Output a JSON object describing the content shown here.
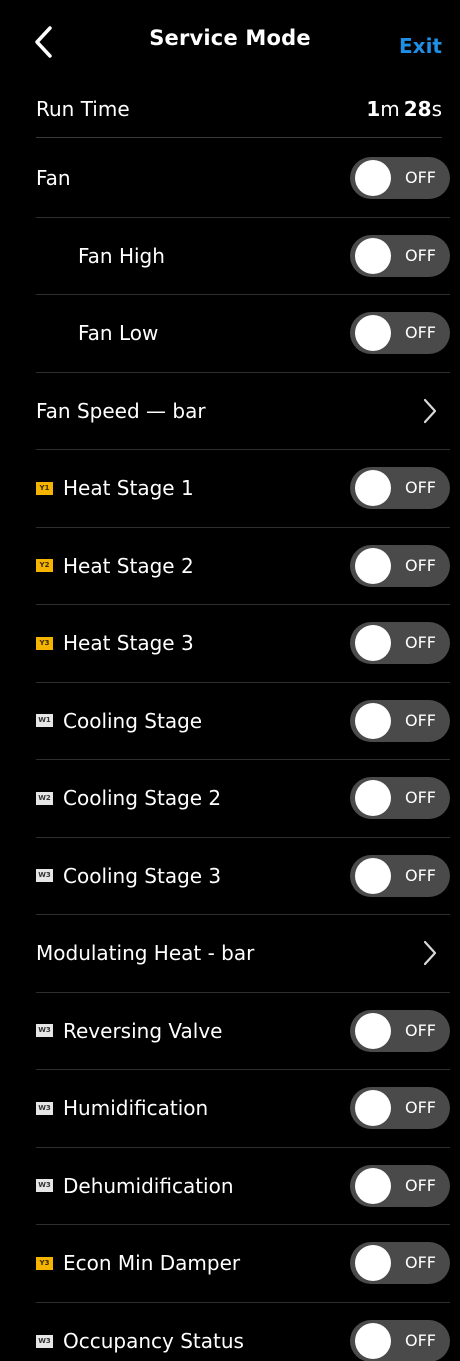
{
  "header": {
    "title": "Service Mode",
    "exit_label": "Exit",
    "accent_color": "#1f8fe5"
  },
  "run_time": {
    "label": "Run Time",
    "minutes": "1",
    "minutes_unit": "m",
    "seconds": "28",
    "seconds_unit": "s"
  },
  "rows": [
    {
      "kind": "toggle",
      "label": "Fan",
      "indent": false,
      "badge": "",
      "badge_color": "",
      "state": "OFF"
    },
    {
      "kind": "toggle",
      "label": "Fan High",
      "indent": true,
      "badge": "",
      "badge_color": "",
      "state": "OFF"
    },
    {
      "kind": "toggle",
      "label": "Fan Low",
      "indent": true,
      "badge": "",
      "badge_color": "",
      "state": "OFF"
    },
    {
      "kind": "nav",
      "label": "Fan Speed — bar",
      "indent": false,
      "badge": "",
      "badge_color": ""
    },
    {
      "kind": "toggle",
      "label": "Heat Stage 1",
      "indent": false,
      "badge": "Y1",
      "badge_color": "yellow",
      "state": "OFF"
    },
    {
      "kind": "toggle",
      "label": "Heat Stage 2",
      "indent": false,
      "badge": "Y2",
      "badge_color": "yellow",
      "state": "OFF"
    },
    {
      "kind": "toggle",
      "label": "Heat Stage 3",
      "indent": false,
      "badge": "Y3",
      "badge_color": "yellow",
      "state": "OFF"
    },
    {
      "kind": "toggle",
      "label": "Cooling Stage",
      "indent": false,
      "badge": "W1",
      "badge_color": "white",
      "state": "OFF"
    },
    {
      "kind": "toggle",
      "label": "Cooling Stage 2",
      "indent": false,
      "badge": "W2",
      "badge_color": "white",
      "state": "OFF"
    },
    {
      "kind": "toggle",
      "label": "Cooling Stage 3",
      "indent": false,
      "badge": "W3",
      "badge_color": "white",
      "state": "OFF"
    },
    {
      "kind": "nav",
      "label": "Modulating Heat - bar",
      "indent": false,
      "badge": "",
      "badge_color": ""
    },
    {
      "kind": "toggle",
      "label": "Reversing Valve",
      "indent": false,
      "badge": "W3",
      "badge_color": "white",
      "state": "OFF"
    },
    {
      "kind": "toggle",
      "label": "Humidification",
      "indent": false,
      "badge": "W3",
      "badge_color": "white",
      "state": "OFF"
    },
    {
      "kind": "toggle",
      "label": "Dehumidification",
      "indent": false,
      "badge": "W3",
      "badge_color": "white",
      "state": "OFF"
    },
    {
      "kind": "toggle",
      "label": "Econ Min Damper",
      "indent": false,
      "badge": "Y3",
      "badge_color": "yellow",
      "state": "OFF"
    },
    {
      "kind": "toggle",
      "label": "Occupancy Status",
      "indent": false,
      "badge": "W3",
      "badge_color": "white",
      "state": "OFF"
    }
  ]
}
